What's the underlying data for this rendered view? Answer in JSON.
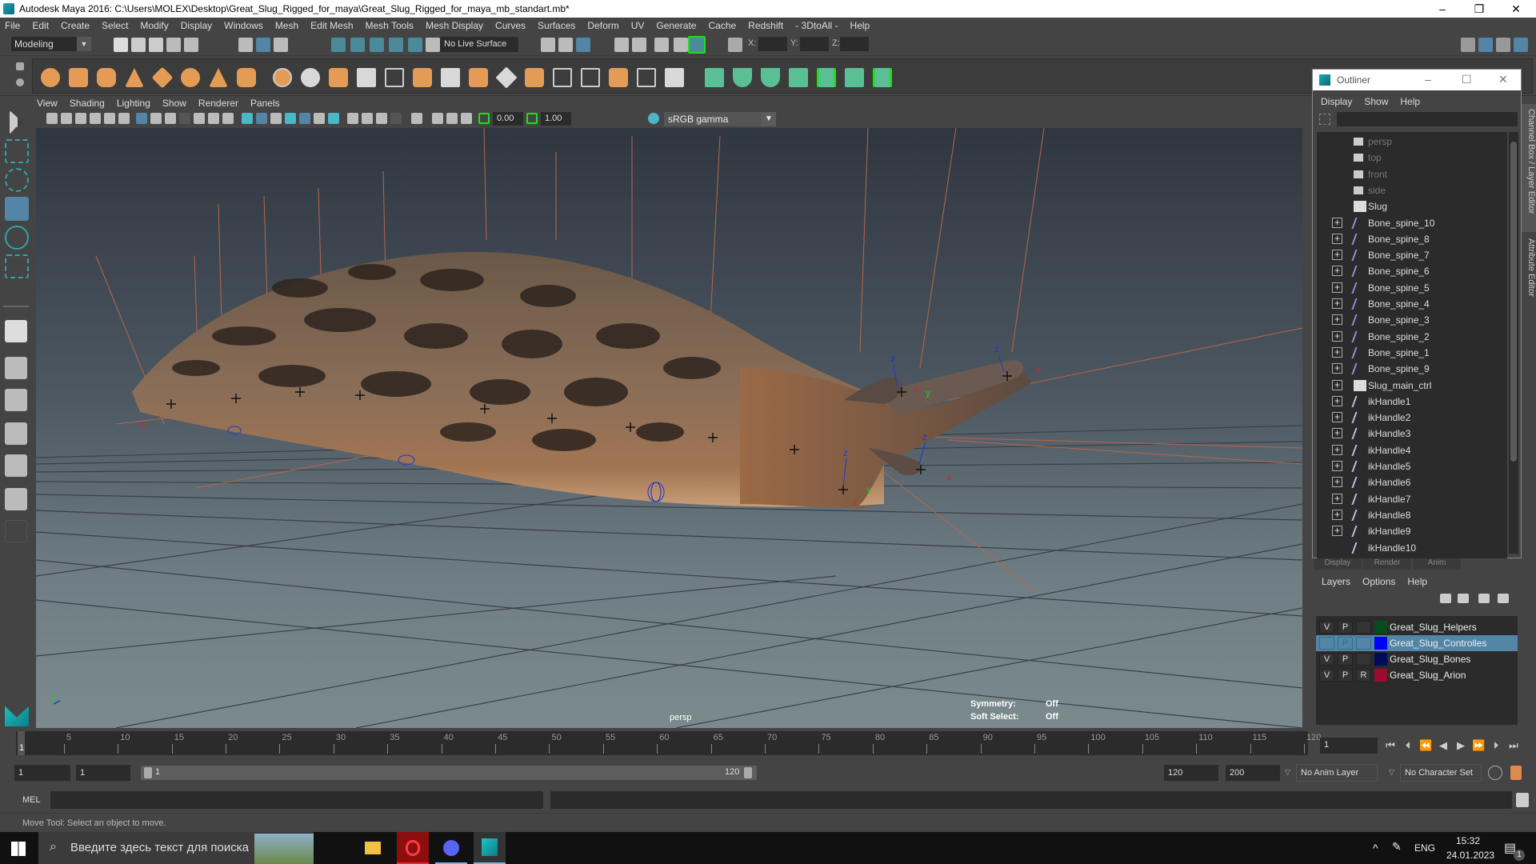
{
  "window": {
    "title": "Autodesk Maya 2016: C:\\Users\\MOLEX\\Desktop\\Great_Slug_Rigged_for_maya\\Great_Slug_Rigged_for_maya_mb_standart.mb*",
    "minimize": "–",
    "maximize": "❐",
    "close": "✕"
  },
  "menubar": [
    "File",
    "Edit",
    "Create",
    "Select",
    "Modify",
    "Display",
    "Windows",
    "Mesh",
    "Edit Mesh",
    "Mesh Tools",
    "Mesh Display",
    "Curves",
    "Surfaces",
    "Deform",
    "UV",
    "Generate",
    "Cache",
    "Redshift",
    "- 3DtoAll -",
    "Help"
  ],
  "statusline": {
    "mode": "Modeling",
    "live_surface": "No Live Surface",
    "x_label": "X:",
    "y_label": "Y:",
    "z_label": "Z:"
  },
  "viewport": {
    "menu": [
      "View",
      "Shading",
      "Lighting",
      "Show",
      "Renderer",
      "Panels"
    ],
    "exposure": "0.00",
    "gamma": "1.00",
    "color_management": "sRGB gamma",
    "camera_label": "persp",
    "hud": {
      "symmetry_label": "Symmetry:",
      "symmetry_value": "Off",
      "soft_select_label": "Soft Select:",
      "soft_select_value": "Off"
    }
  },
  "outliner": {
    "title": "Outliner",
    "menu": [
      "Display",
      "Show",
      "Help"
    ],
    "items": [
      {
        "label": "persp",
        "type": "camera",
        "dim": true,
        "expand": false
      },
      {
        "label": "top",
        "type": "camera",
        "dim": true,
        "expand": false
      },
      {
        "label": "front",
        "type": "camera",
        "dim": true,
        "expand": false
      },
      {
        "label": "side",
        "type": "camera",
        "dim": true,
        "expand": false
      },
      {
        "label": "Slug",
        "type": "mesh",
        "dim": false,
        "expand": false
      },
      {
        "label": "Bone_spine_10",
        "type": "joint",
        "dim": false,
        "expand": true
      },
      {
        "label": "Bone_spine_8",
        "type": "joint",
        "dim": false,
        "expand": true
      },
      {
        "label": "Bone_spine_7",
        "type": "joint",
        "dim": false,
        "expand": true
      },
      {
        "label": "Bone_spine_6",
        "type": "joint",
        "dim": false,
        "expand": true
      },
      {
        "label": "Bone_spine_5",
        "type": "joint",
        "dim": false,
        "expand": true
      },
      {
        "label": "Bone_spine_4",
        "type": "joint",
        "dim": false,
        "expand": true
      },
      {
        "label": "Bone_spine_3",
        "type": "joint",
        "dim": false,
        "expand": true
      },
      {
        "label": "Bone_spine_2",
        "type": "joint",
        "dim": false,
        "expand": true
      },
      {
        "label": "Bone_spine_1",
        "type": "joint",
        "dim": false,
        "expand": true
      },
      {
        "label": "Bone_spine_9",
        "type": "joint",
        "dim": false,
        "expand": true
      },
      {
        "label": "Slug_main_ctrl",
        "type": "mesh",
        "dim": false,
        "expand": true
      },
      {
        "label": "ikHandle1",
        "type": "ik",
        "dim": false,
        "expand": true
      },
      {
        "label": "ikHandle2",
        "type": "ik",
        "dim": false,
        "expand": true
      },
      {
        "label": "ikHandle3",
        "type": "ik",
        "dim": false,
        "expand": true
      },
      {
        "label": "ikHandle4",
        "type": "ik",
        "dim": false,
        "expand": true
      },
      {
        "label": "ikHandle5",
        "type": "ik",
        "dim": false,
        "expand": true
      },
      {
        "label": "ikHandle6",
        "type": "ik",
        "dim": false,
        "expand": true
      },
      {
        "label": "ikHandle7",
        "type": "ik",
        "dim": false,
        "expand": true
      },
      {
        "label": "ikHandle8",
        "type": "ik",
        "dim": false,
        "expand": true
      },
      {
        "label": "ikHandle9",
        "type": "ik",
        "dim": false,
        "expand": true
      },
      {
        "label": "ikHandle10",
        "type": "ik",
        "dim": false,
        "expand": false
      }
    ]
  },
  "side_tabs": [
    "Channel Box / Layer Editor",
    "Attribute Editor"
  ],
  "layer_editor": {
    "tabs": [
      "Display",
      "Render",
      "Anim"
    ],
    "menu": [
      "Layers",
      "Options",
      "Help"
    ],
    "layers": [
      {
        "v": "V",
        "p": "P",
        "r": "",
        "color": "#0b4a1f",
        "name": "Great_Slug_Helpers",
        "selected": false
      },
      {
        "v": "",
        "p": "P",
        "r": "",
        "color": "#0000ff",
        "name": "Great_Slug_Controlles",
        "selected": true
      },
      {
        "v": "V",
        "p": "P",
        "r": "",
        "color": "#000a5a",
        "name": "Great_Slug_Bones",
        "selected": false
      },
      {
        "v": "V",
        "p": "P",
        "r": "R",
        "color": "#9a0b2e",
        "name": "Great_Slug_Arion",
        "selected": false
      }
    ]
  },
  "timeline": {
    "start": 1,
    "end": 120,
    "ticks": [
      5,
      10,
      15,
      20,
      25,
      30,
      35,
      40,
      45,
      50,
      55,
      60,
      65,
      70,
      75,
      80,
      85,
      90,
      95,
      100,
      105,
      110,
      115,
      120
    ],
    "current_marker": "1",
    "current_frame": "1"
  },
  "range": {
    "start_field": "1",
    "playback_start": "1",
    "range_start_label": "1",
    "range_end_label": "120",
    "playback_end": "120",
    "end_field": "200",
    "anim_layer": "No Anim Layer",
    "character_set": "No Character Set"
  },
  "command_line": {
    "label": "MEL"
  },
  "help_line": "Move Tool: Select an object to move.",
  "taskbar": {
    "search_placeholder": "Введите здесь текст для поиска",
    "lang": "ENG",
    "time": "15:32",
    "date": "24.01.2023",
    "notifications": "1"
  },
  "colors": {
    "accent": "#5285a6",
    "shelf_orange": "#e39b55",
    "shelf_green": "#5bbf96",
    "bracket_green": "#22dd22"
  }
}
